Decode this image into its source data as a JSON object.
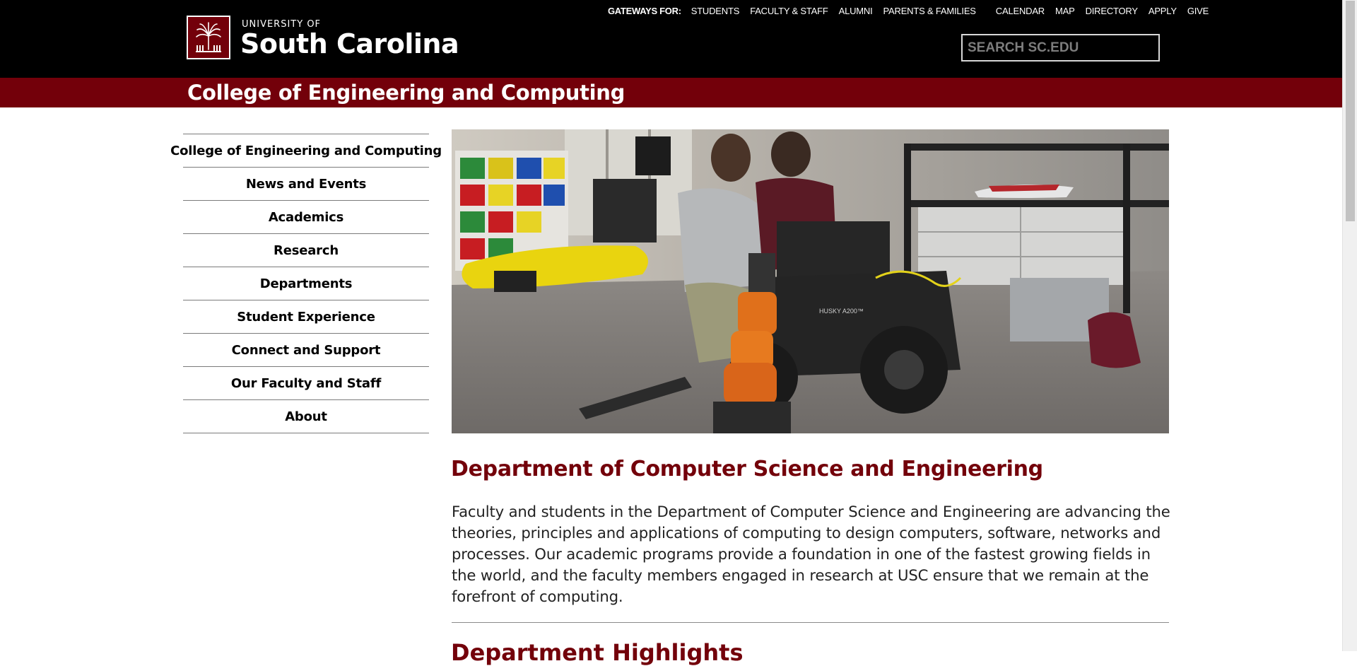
{
  "header": {
    "logo": {
      "line1": "UNIVERSITY OF",
      "line2": "South Carolina"
    },
    "gateways_label": "GATEWAYS FOR:",
    "gateways": [
      "STUDENTS",
      "FACULTY & STAFF",
      "ALUMNI",
      "PARENTS & FAMILIES"
    ],
    "utility_links": [
      "CALENDAR",
      "MAP",
      "DIRECTORY",
      "APPLY",
      "GIVE"
    ],
    "search": {
      "placeholder": "SEARCH SC.EDU",
      "value": ""
    }
  },
  "college_bar": {
    "title": "College of Engineering and Computing"
  },
  "sidebar": {
    "items": [
      {
        "label": "College of Engineering and Computing"
      },
      {
        "label": "News and Events"
      },
      {
        "label": "Academics"
      },
      {
        "label": "Research"
      },
      {
        "label": "Departments"
      },
      {
        "label": "Student Experience"
      },
      {
        "label": "Connect and Support"
      },
      {
        "label": "Our Faculty and Staff"
      },
      {
        "label": "About"
      }
    ]
  },
  "hero": {
    "robot_label": "HUSKY A200™"
  },
  "main": {
    "heading": "Department of Computer Science and Engineering",
    "body": "Faculty and students in the Department of Computer Science and Engineering are advancing the theories, principles and applications of computing to design computers, software, networks and processes. Our academic programs provide a foundation in one of the fastest growing fields in the world, and the faculty members engaged in research at USC ensure that we remain at the forefront of computing.",
    "next_heading": "Department Highlights"
  },
  "colors": {
    "garnet": "#73000a",
    "black": "#000000",
    "white": "#ffffff"
  }
}
